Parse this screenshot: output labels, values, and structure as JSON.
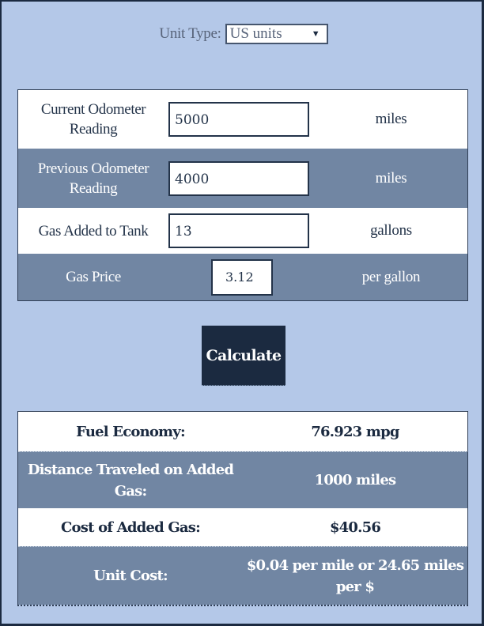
{
  "unit_type": {
    "label": "Unit Type:",
    "selected": "US units",
    "arrow_icon": "▼"
  },
  "inputs": [
    {
      "label": "Current Odometer Reading",
      "value": "5000",
      "unit": "miles"
    },
    {
      "label": "Previous Odometer Reading",
      "value": "4000",
      "unit": "miles"
    },
    {
      "label": "Gas Added to Tank",
      "value": "13",
      "unit": "gallons"
    },
    {
      "label": "Gas Price",
      "value": "3.12",
      "unit": "per gallon"
    }
  ],
  "calculate_label": "Calculate",
  "results": [
    {
      "label": "Fuel Economy:",
      "value": "76.923 mpg"
    },
    {
      "label": "Distance Traveled on Added Gas:",
      "value": "1000 miles"
    },
    {
      "label": "Cost of Added Gas:",
      "value": "$40.56"
    },
    {
      "label": "Unit Cost:",
      "value": "$0.04 per mile or 24.65 miles per $"
    }
  ],
  "colors": {
    "background": "#b4c8e8",
    "dark_row": "#7186a3",
    "button": "#1b2a40",
    "text_dark": "#233349"
  }
}
